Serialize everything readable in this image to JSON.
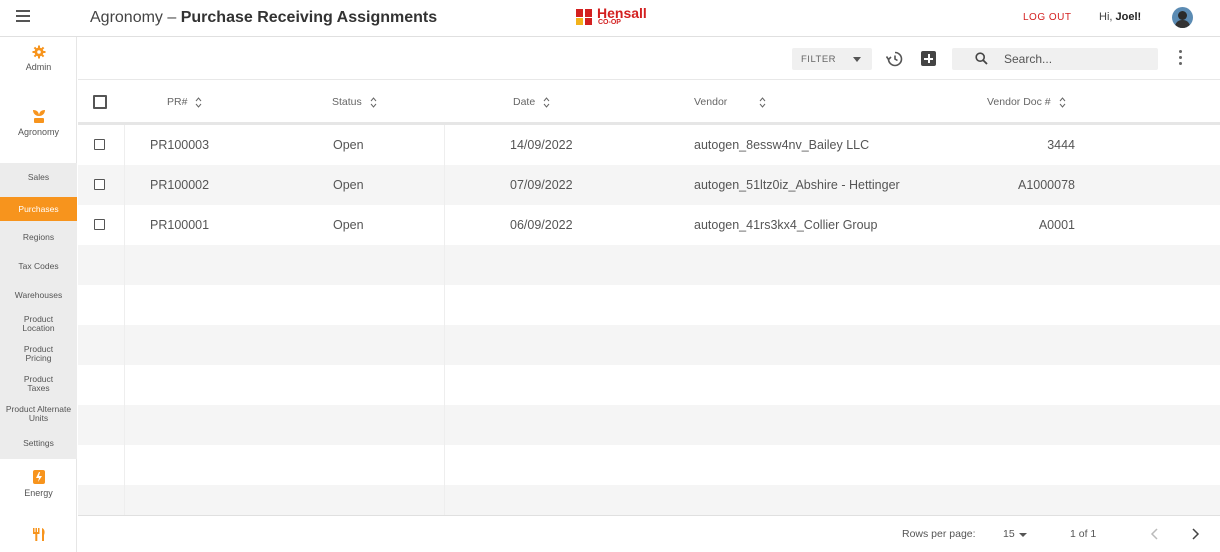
{
  "header": {
    "title_prefix": "Agronomy – ",
    "title_main": "Purchase Receiving Assignments",
    "logo_text": "Hensall",
    "logo_sub": "CO-OP",
    "logout_label": "LOG OUT",
    "greeting_prefix": "Hi, ",
    "user_name": "Joel!"
  },
  "sidebar": {
    "sections": [
      {
        "label": "Admin",
        "icon": "gear-icon"
      },
      {
        "label": "Agronomy",
        "icon": "sprout-icon"
      },
      {
        "label": "Energy",
        "icon": "fuel-icon"
      },
      {
        "label": "",
        "icon": "fork-knife-icon"
      }
    ],
    "sub_items": [
      {
        "label": "Sales"
      },
      {
        "label": "Purchases",
        "active": true
      },
      {
        "label": "Regions"
      },
      {
        "label": "Tax Codes"
      },
      {
        "label": "Warehouses"
      },
      {
        "label": "Product Location"
      },
      {
        "label": "Product Pricing"
      },
      {
        "label": "Product Taxes"
      },
      {
        "label": "Product Alternate Units"
      },
      {
        "label": "Settings"
      }
    ]
  },
  "toolbar": {
    "filter_label": "FILTER",
    "search_placeholder": "Search..."
  },
  "table": {
    "columns": [
      "PR#",
      "Status",
      "Date",
      "Vendor",
      "Vendor Doc #"
    ],
    "rows": [
      {
        "pr": "PR100003",
        "status": "Open",
        "date": "14/09/2022",
        "vendor": "autogen_8essw4nv_Bailey LLC",
        "vendor_doc": "3444"
      },
      {
        "pr": "PR100002",
        "status": "Open",
        "date": "07/09/2022",
        "vendor": "autogen_51ltz0iz_Abshire - Hettinger",
        "vendor_doc": "A1000078"
      },
      {
        "pr": "PR100001",
        "status": "Open",
        "date": "06/09/2022",
        "vendor": "autogen_41rs3kx4_Collier Group",
        "vendor_doc": "A0001"
      }
    ]
  },
  "footer": {
    "rows_per_page_label": "Rows per page:",
    "rows_per_page_value": "15",
    "page_info": "1 of 1"
  },
  "colors": {
    "accent": "#f7941d",
    "brand_red": "#d32020",
    "stripe": "#f5f5f5"
  }
}
